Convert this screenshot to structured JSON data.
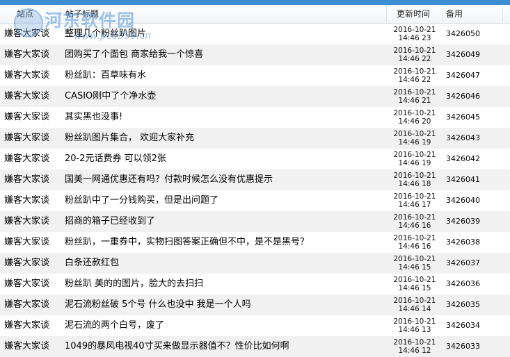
{
  "header": {
    "site": "站点",
    "title": "帖子标题",
    "time": "更新时间",
    "note": "备用"
  },
  "watermark": {
    "text": "河东软件园",
    "url": "www.pc0359.cn"
  },
  "rows": [
    {
      "site": "嫌客大家谈",
      "title": "整理几个粉丝趴图片",
      "date": "2016-10-21",
      "time": "14:46 23",
      "id": "3426050"
    },
    {
      "site": "嫌客大家谈",
      "title": "团购买了个面包  商家给我一个惊喜",
      "date": "2016-10-21",
      "time": "14:46 22",
      "id": "3426049"
    },
    {
      "site": "嫌客大家谈",
      "title": "粉丝趴：百草味有水",
      "date": "2016-10-21",
      "time": "14:46 22",
      "id": "3426047"
    },
    {
      "site": "嫌客大家谈",
      "title": "CASIO刚中了个净水壶",
      "date": "2016-10-21",
      "time": "14:46 21",
      "id": "3426046"
    },
    {
      "site": "嫌客大家谈",
      "title": "其实黑也没事!",
      "date": "2016-10-21",
      "time": "14:46 20",
      "id": "3426045"
    },
    {
      "site": "嫌客大家谈",
      "title": "粉丝趴图片集合， 欢迎大家补充",
      "date": "2016-10-21",
      "time": "14:46 19",
      "id": "3426043"
    },
    {
      "site": "嫌客大家谈",
      "title": "20-2元话费券 可以领2张",
      "date": "2016-10-21",
      "time": "14:46 19",
      "id": "3426042"
    },
    {
      "site": "嫌客大家谈",
      "title": "国美一网通优惠还有吗？付款时候怎么没有优惠提示",
      "date": "2016-10-21",
      "time": "14:46 18",
      "id": "3426041"
    },
    {
      "site": "嫌客大家谈",
      "title": "粉丝趴中了一分钱购买，但是出问题了",
      "date": "2016-10-21",
      "time": "14:46 17",
      "id": "3426040"
    },
    {
      "site": "嫌客大家谈",
      "title": "招商的箱子已经收到了",
      "date": "2016-10-21",
      "time": "14:46 16",
      "id": "3426039"
    },
    {
      "site": "嫌客大家谈",
      "title": "粉丝趴，一重券中，实物扫图答案正确但不中，是不是黑号？",
      "date": "2016-10-21",
      "time": "14:46 16",
      "id": "3426038"
    },
    {
      "site": "嫌客大家谈",
      "title": "白条还款红包",
      "date": "2016-10-21",
      "time": "14:46 15",
      "id": "3426037"
    },
    {
      "site": "嫌客大家谈",
      "title": "粉丝趴 美的的图片，脸大的去扫扫",
      "date": "2016-10-21",
      "time": "14:46 15",
      "id": "3426036"
    },
    {
      "site": "嫌客大家谈",
      "title": "泥石流粉丝破 5个号 什么也没中 我是一个人吗",
      "date": "2016-10-21",
      "time": "14:46 14",
      "id": "3426035"
    },
    {
      "site": "嫌客大家谈",
      "title": "泥石流的两个白号，废了",
      "date": "2016-10-21",
      "time": "14:46 13",
      "id": "3426034"
    },
    {
      "site": "嫌客大家谈",
      "title": "1049的暴风电视40寸买来做显示器值不？性价比如何啊",
      "date": "2016-10-21",
      "time": "14:46 12",
      "id": "3426033"
    }
  ]
}
